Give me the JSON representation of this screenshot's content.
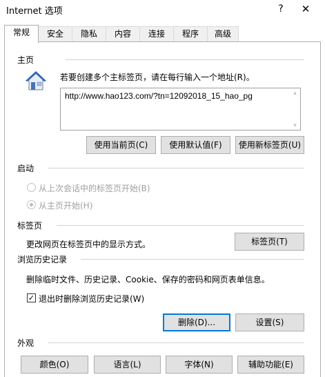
{
  "window": {
    "title": "Internet 选项",
    "help_label": "?",
    "close_label": "✕"
  },
  "tabs": [
    {
      "label": "常规",
      "active": true
    },
    {
      "label": "安全"
    },
    {
      "label": "隐私"
    },
    {
      "label": "内容"
    },
    {
      "label": "连接"
    },
    {
      "label": "程序"
    },
    {
      "label": "高级"
    }
  ],
  "home": {
    "section_title": "主页",
    "instruction": "若要创建多个主标签页，请在每行输入一个地址(R)。",
    "url_value": "http://www.hao123.com/?tn=12092018_15_hao_pg",
    "icon": "home-page-icon",
    "buttons": {
      "use_current": "使用当前页(C)",
      "use_default": "使用默认值(F)",
      "use_new_tab": "使用新标签页(U)"
    }
  },
  "startup": {
    "section_title": "启动",
    "option_last_session": "从上次会话中的标签页开始(B)",
    "option_home_page": "从主页开始(H)",
    "selected": "option_home_page"
  },
  "tabs_section": {
    "section_title": "标签页",
    "description": "更改网页在标签页中的显示方式。",
    "button": "标签页(T)"
  },
  "history": {
    "section_title": "浏览历史记录",
    "description": "删除临时文件、历史记录、Cookie、保存的密码和网页表单信息。",
    "checkbox_label": "退出时删除浏览历史记录(W)",
    "checkbox_checked": true,
    "checkbox_mark": "✓",
    "delete_button": "删除(D)...",
    "settings_button": "设置(S)"
  },
  "appearance": {
    "section_title": "外观",
    "buttons": {
      "colors": "颜色(O)",
      "languages": "语言(L)",
      "fonts": "字体(N)",
      "accessibility": "辅助功能(E)"
    }
  }
}
